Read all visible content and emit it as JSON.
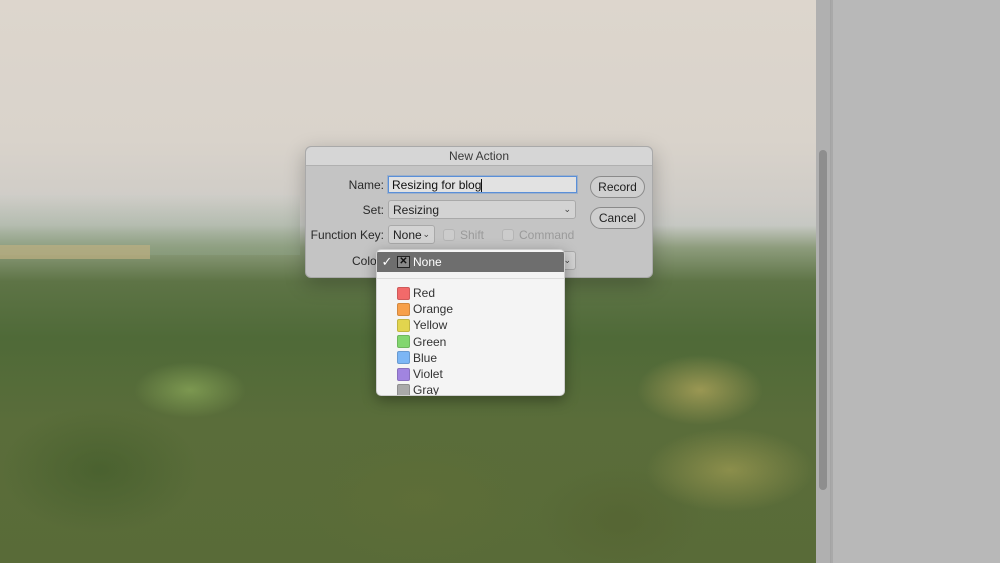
{
  "dialog": {
    "title": "New Action",
    "name_label": "Name:",
    "name_value": "Resizing for blog",
    "set_label": "Set:",
    "set_value": "Resizing",
    "function_key_label": "Function Key:",
    "function_key_value": "None",
    "shift_label": "Shift",
    "command_label": "Command",
    "color_label": "Color:",
    "record_label": "Record",
    "cancel_label": "Cancel"
  },
  "color_menu": {
    "selected": {
      "label": "None",
      "icon": "x-box-icon",
      "checked": true
    },
    "items": [
      {
        "label": "Red",
        "color": "#f26a6a"
      },
      {
        "label": "Orange",
        "color": "#f7a04a"
      },
      {
        "label": "Yellow",
        "color": "#e2d54e"
      },
      {
        "label": "Green",
        "color": "#82d66f"
      },
      {
        "label": "Blue",
        "color": "#7cb6f5"
      },
      {
        "label": "Violet",
        "color": "#a184e0"
      },
      {
        "label": "Gray",
        "color": "#a9a9a9"
      }
    ]
  }
}
